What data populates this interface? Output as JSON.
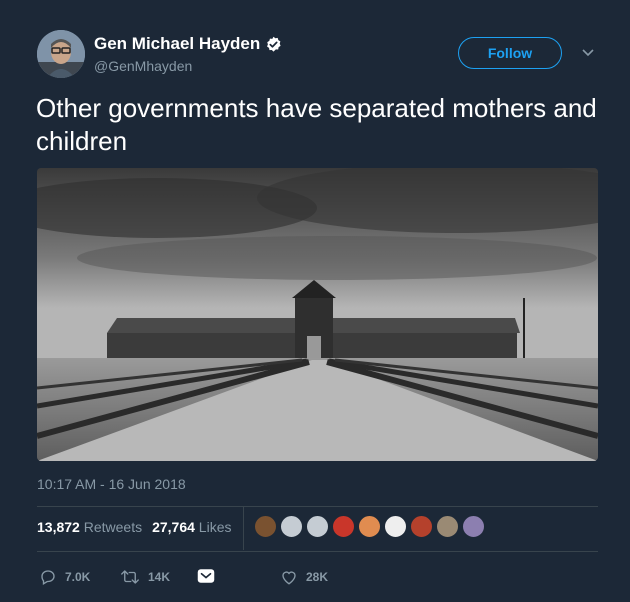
{
  "tweet": {
    "display_name": "Gen Michael Hayden",
    "handle": "@GenMhayden",
    "verified": true,
    "follow_label": "Follow",
    "text": "Other governments have separated mothers and children",
    "timestamp": "10:17 AM - 16 Jun 2018"
  },
  "stats": {
    "retweets_count": "13,872",
    "retweets_label": "Retweets",
    "likes_count": "27,764",
    "likes_label": "Likes"
  },
  "actions": {
    "replies": "7.0K",
    "retweets": "14K",
    "likes": "28K"
  },
  "icons": {
    "verified": "verified-badge-icon",
    "caret": "chevron-down-icon",
    "reply": "reply-icon",
    "retweet": "retweet-icon",
    "dm": "direct-message-icon",
    "like": "heart-icon"
  },
  "colors": {
    "background": "#1c2837",
    "accent": "#1da1f2",
    "muted": "#8899a6",
    "divider": "#38444d"
  }
}
